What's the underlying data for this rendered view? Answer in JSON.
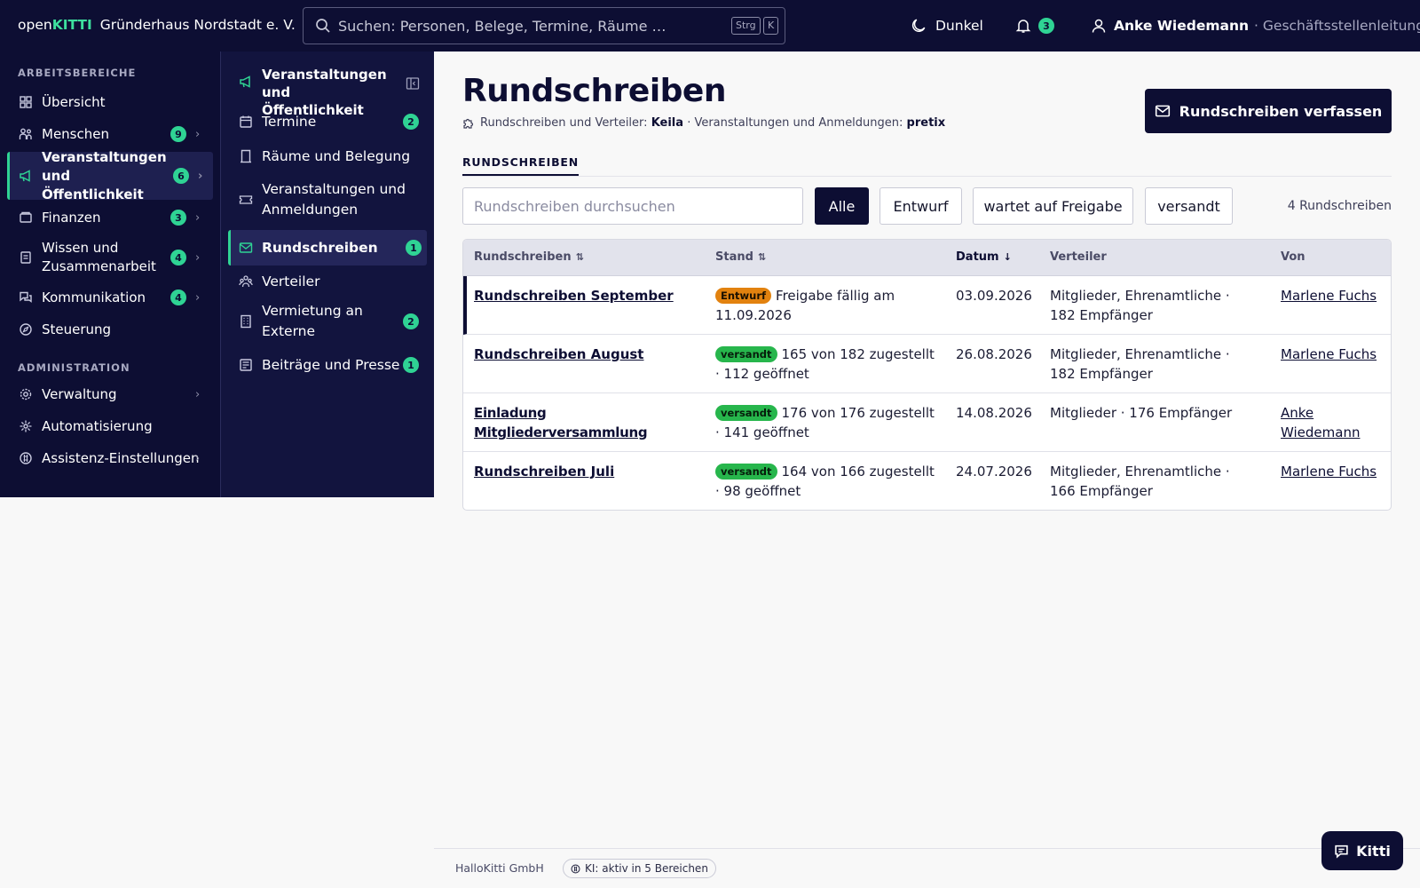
{
  "brand": {
    "prefix": "open",
    "suffix": "KITTI",
    "org": "Gründerhaus Nordstadt e. V."
  },
  "search": {
    "placeholder": "Suchen: Personen, Belege, Termine, Räume …",
    "kbd_ctrl": "Strg",
    "kbd_key": "K"
  },
  "topbar": {
    "theme_label": "Dunkel",
    "notifications_count": "3",
    "user_name": "Anke Wiedemann",
    "user_role": "· Geschäftsstellenleitung"
  },
  "sidebar": {
    "section_work": "ARBEITSBEREICHE",
    "section_admin": "ADMINISTRATION",
    "items": [
      {
        "label": "Übersicht",
        "icon": "dashboard-icon"
      },
      {
        "label": "Menschen",
        "badge": "9",
        "icon": "people-icon"
      },
      {
        "label": "Veranstaltungen und Öffentlichkeit",
        "badge": "6",
        "icon": "megaphone-icon"
      },
      {
        "label": "Finanzen",
        "badge": "3",
        "icon": "finance-icon"
      },
      {
        "label": "Wissen und Zusammenarbeit",
        "badge": "4",
        "icon": "book-icon"
      },
      {
        "label": "Kommunikation",
        "badge": "4",
        "icon": "chat-icon"
      },
      {
        "label": "Steuerung",
        "icon": "compass-icon"
      }
    ],
    "admin_items": [
      {
        "label": "Verwaltung",
        "icon": "gear-icon"
      },
      {
        "label": "Automatisierung",
        "icon": "automation-icon"
      },
      {
        "label": "Assistenz-Einstellungen",
        "icon": "ai-icon"
      }
    ]
  },
  "subnav": {
    "title": "Veranstaltungen und Öffentlichkeit",
    "items": [
      {
        "label": "Termine",
        "badge": "2",
        "icon": "calendar-icon"
      },
      {
        "label": "Räume und Belegung",
        "icon": "door-icon"
      },
      {
        "label": "Veranstaltungen und Anmeldungen",
        "icon": "ticket-icon"
      },
      {
        "label": "Rundschreiben",
        "badge": "1",
        "icon": "mail-icon"
      },
      {
        "label": "Verteiler",
        "icon": "distribution-icon"
      },
      {
        "label": "Vermietung an Externe",
        "badge": "2",
        "icon": "building-icon"
      },
      {
        "label": "Beiträge und Presse",
        "badge": "1",
        "icon": "newspaper-icon"
      }
    ]
  },
  "main": {
    "title": "Rundschreiben",
    "sub_label_1": "Rundschreiben und Verteiler:",
    "sub_value_1": "Keila",
    "sub_label_2": "· Veranstaltungen und Anmeldungen:",
    "sub_value_2": "pretix",
    "compose_label": "Rundschreiben verfassen",
    "tab_label": "RUNDSCHREIBEN",
    "filter_placeholder": "Rundschreiben durchsuchen",
    "filters": [
      "Alle",
      "Entwurf",
      "wartet auf Freigabe",
      "versandt"
    ],
    "count_label": "4 Rundschreiben",
    "columns": [
      "Rundschreiben",
      "Stand",
      "Datum",
      "Verteiler",
      "Von"
    ],
    "rows": [
      {
        "title": "Rundschreiben September",
        "status": "Entwurf",
        "status_text": "Freigabe fällig am 11.09.2026",
        "date": "03.09.2026",
        "lists": "Mitglieder, Ehrenamtliche · 182 Empfänger",
        "author": "Marlene Fuchs"
      },
      {
        "title": "Rundschreiben August",
        "status": "versandt",
        "status_text": "165 von 182 zugestellt · 112 geöffnet",
        "date": "26.08.2026",
        "lists": "Mitglieder, Ehrenamtliche · 182 Empfänger",
        "author": "Marlene Fuchs"
      },
      {
        "title": "Einladung Mitgliederversammlung",
        "status": "versandt",
        "status_text": "176 von 176 zugestellt · 141 geöffnet",
        "date": "14.08.2026",
        "lists": "Mitglieder · 176 Empfänger",
        "author": "Anke Wiedemann"
      },
      {
        "title": "Rundschreiben Juli",
        "status": "versandt",
        "status_text": "164 von 166 zugestellt · 98 geöffnet",
        "date": "24.07.2026",
        "lists": "Mitglieder, Ehrenamtliche · 166 Empfänger",
        "author": "Marlene Fuchs"
      }
    ]
  },
  "footer": {
    "company": "HalloKitti GmbH",
    "ki_chip": "KI: aktiv in 5 Bereichen"
  },
  "assistant": {
    "label": "Kitti"
  },
  "colors": {
    "navy": "#0d0e33",
    "accent": "#2fd394",
    "draft": "#e2820f",
    "sent": "#27b64c"
  }
}
